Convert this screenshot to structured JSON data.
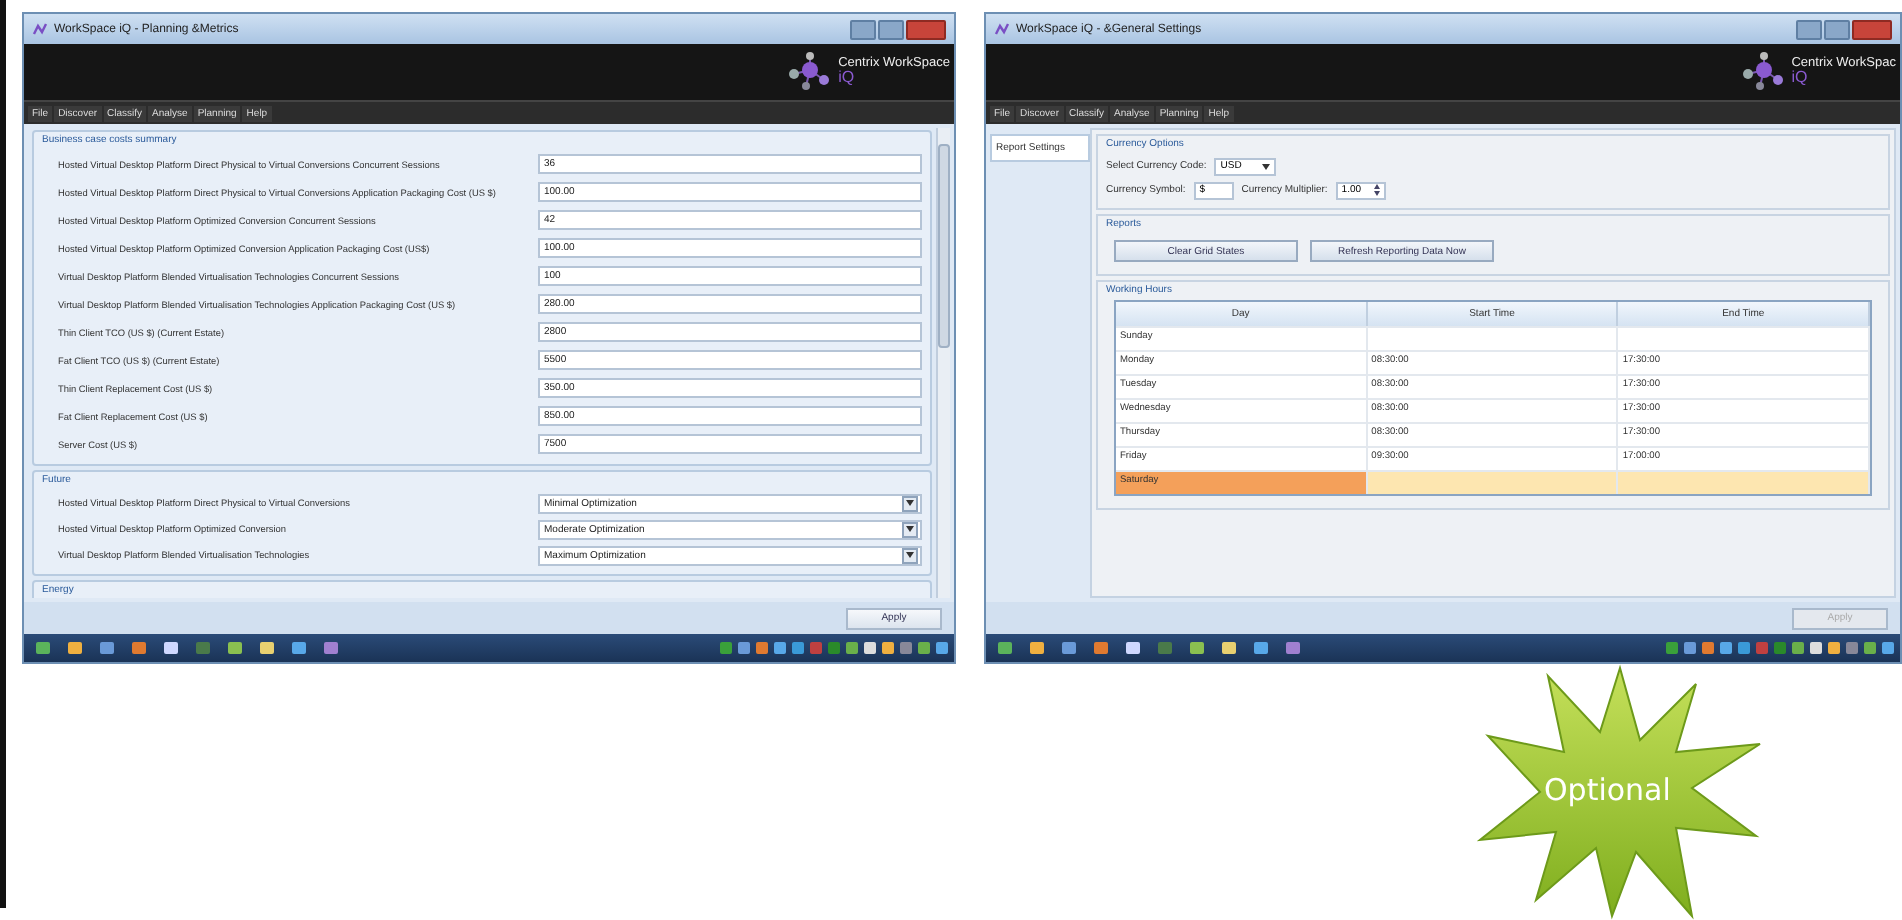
{
  "left_window": {
    "title": "WorkSpace iQ - Planning &Metrics",
    "logo": {
      "name": "Centrix WorkSpace",
      "suffix": "iQ"
    },
    "menu": [
      "File",
      "Discover",
      "Classify",
      "Analyse",
      "Planning",
      "Help"
    ],
    "business_case": {
      "title": "Business case costs summary",
      "rows": [
        {
          "label": "Hosted Virtual Desktop Platform Direct Physical to Virtual Conversions Concurrent Sessions",
          "value": "36"
        },
        {
          "label": "Hosted Virtual Desktop Platform Direct Physical to Virtual Conversions Application Packaging Cost (US $)",
          "value": "100.00"
        },
        {
          "label": "Hosted Virtual Desktop Platform Optimized Conversion Concurrent Sessions",
          "value": "42"
        },
        {
          "label": "Hosted Virtual Desktop Platform Optimized Conversion Application Packaging Cost (US$)",
          "value": "100.00"
        },
        {
          "label": "Virtual Desktop Platform Blended Virtualisation Technologies Concurrent Sessions",
          "value": "100"
        },
        {
          "label": "Virtual Desktop Platform Blended Virtualisation Technologies Application Packaging Cost (US $)",
          "value": "280.00"
        },
        {
          "label": "Thin Client TCO (US $) (Current Estate)",
          "value": "2800"
        },
        {
          "label": "Fat Client TCO (US $) (Current Estate)",
          "value": "5500"
        },
        {
          "label": "Thin Client Replacement Cost (US $)",
          "value": "350.00"
        },
        {
          "label": "Fat Client Replacement Cost (US $)",
          "value": "850.00"
        },
        {
          "label": "Server Cost (US $)",
          "value": "7500"
        }
      ]
    },
    "future": {
      "title": "Future",
      "rows": [
        {
          "label": "Hosted Virtual Desktop Platform Direct Physical to Virtual Conversions",
          "value": "Minimal Optimization"
        },
        {
          "label": "Hosted Virtual Desktop Platform Optimized Conversion",
          "value": "Moderate Optimization"
        },
        {
          "label": "Virtual Desktop Platform Blended Virtualisation Technologies",
          "value": "Maximum Optimization"
        }
      ]
    },
    "energy": {
      "title": "Energy"
    },
    "apply": {
      "label": "Apply",
      "disabled": false
    }
  },
  "right_window": {
    "title": "WorkSpace iQ - &General Settings",
    "logo": {
      "name": "Centrix WorkSpac",
      "suffix": "iQ"
    },
    "menu": [
      "File",
      "Discover",
      "Classify",
      "Analyse",
      "Planning",
      "Help"
    ],
    "side_tabs": [
      {
        "label": "Report Settings",
        "selected": true
      }
    ],
    "currency": {
      "title": "Currency Options",
      "code_label": "Select Currency Code:",
      "code": "USD",
      "symbol_label": "Currency Symbol:",
      "symbol": "$",
      "multiplier_label": "Currency Multiplier:",
      "multiplier": "1.00"
    },
    "reports": {
      "title": "Reports",
      "buttons": [
        "Clear Grid States",
        "Refresh Reporting Data Now"
      ]
    },
    "working_hours": {
      "title": "Working Hours",
      "columns": [
        "Day",
        "Start Time",
        "End Time"
      ],
      "rows": [
        {
          "cells": [
            "Sunday",
            "",
            ""
          ],
          "selected": false
        },
        {
          "cells": [
            "Monday",
            "08:30:00",
            "17:30:00"
          ],
          "selected": false
        },
        {
          "cells": [
            "Tuesday",
            "08:30:00",
            "17:30:00"
          ],
          "selected": false
        },
        {
          "cells": [
            "Wednesday",
            "08:30:00",
            "17:30:00"
          ],
          "selected": false
        },
        {
          "cells": [
            "Thursday",
            "08:30:00",
            "17:30:00"
          ],
          "selected": false
        },
        {
          "cells": [
            "Friday",
            "09:30:00",
            "17:00:00"
          ],
          "selected": false
        },
        {
          "cells": [
            "Saturday",
            "",
            ""
          ],
          "selected": true
        }
      ]
    },
    "apply": {
      "label": "Apply",
      "disabled": true
    }
  },
  "badge": {
    "label": "Optional"
  }
}
